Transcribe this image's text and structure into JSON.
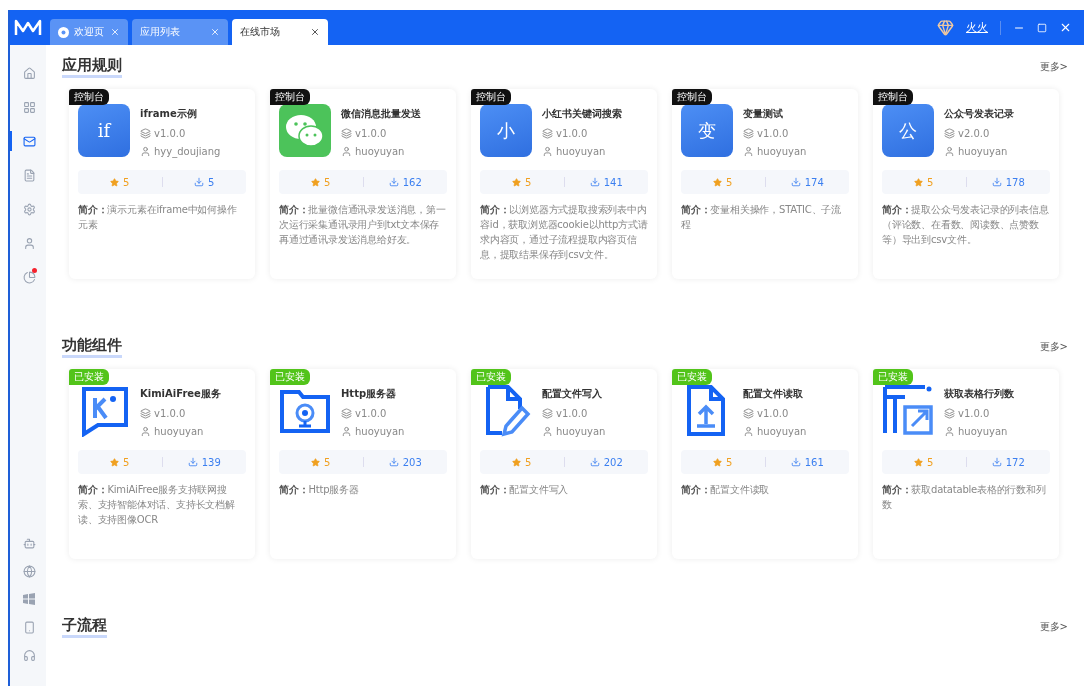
{
  "tabs": [
    {
      "label": "欢迎页",
      "selected": false,
      "kind": "welcome"
    },
    {
      "label": "应用列表",
      "selected": false,
      "kind": "plain"
    },
    {
      "label": "在线市场",
      "selected": true,
      "kind": "plain"
    }
  ],
  "user": {
    "name": "火火"
  },
  "sidebar": {
    "items": [
      {
        "kind": "home",
        "selected": false
      },
      {
        "kind": "grid",
        "selected": false
      },
      {
        "kind": "mail",
        "selected": true
      },
      {
        "kind": "list",
        "selected": false
      },
      {
        "kind": "gear",
        "selected": false
      },
      {
        "kind": "user",
        "selected": false
      },
      {
        "kind": "pie",
        "selected": false,
        "badge": true
      }
    ],
    "bottom": [
      {
        "kind": "robot"
      },
      {
        "kind": "globe"
      },
      {
        "kind": "windows"
      },
      {
        "kind": "phone"
      },
      {
        "kind": "headset"
      }
    ]
  },
  "sections": [
    {
      "title": "应用规则",
      "more": "更多>",
      "cards": [
        {
          "tag": "控制台",
          "color": "#111111",
          "icon": {
            "kind": "tile",
            "text": "if"
          },
          "name": "iframe示例",
          "version": "v1.0.0",
          "author": "hyy_doujiang",
          "stars": "5",
          "downloads": "5",
          "desc": "**简介：**演示元素在iframe中如何操作元素"
        },
        {
          "tag": "控制台",
          "color": "#111111",
          "icon": {
            "kind": "wechat"
          },
          "name": "微信消息批量发送",
          "version": "v1.0.0",
          "author": "huoyuyan",
          "stars": "5",
          "downloads": "162",
          "desc": "**简介：**批量微信通讯录发送消息，第一次运行采集通讯录用户到txt文本保存再通过通讯录发送消息给好友。"
        },
        {
          "tag": "控制台",
          "color": "#111111",
          "icon": {
            "kind": "tile",
            "text": "小"
          },
          "name": "小红书关键词搜索",
          "version": "v1.0.0",
          "author": "huoyuyan",
          "stars": "5",
          "downloads": "141",
          "desc": "**简介：**以浏览器方式提取搜索列表中内容id，获取浏览器cookie以http方式请求内容页，通过子流程提取内容页信息，提取结果保存到csv文件。"
        },
        {
          "tag": "控制台",
          "color": "#111111",
          "icon": {
            "kind": "tile",
            "text": "变"
          },
          "name": "变量测试",
          "version": "v1.0.0",
          "author": "huoyuyan",
          "stars": "5",
          "downloads": "174",
          "desc": "**简介：**变量相关操作，STATIC、子流程"
        },
        {
          "tag": "控制台",
          "color": "#111111",
          "icon": {
            "kind": "tile",
            "text": "公"
          },
          "name": "公众号发表记录",
          "version": "v2.0.0",
          "author": "huoyuyan",
          "stars": "5",
          "downloads": "178",
          "desc": "**简介：**提取公众号发表记录的列表信息（评论数、在看数、阅读数、点赞数等）导出到csv文件。"
        }
      ]
    },
    {
      "title": "功能组件",
      "more": "更多>",
      "cards": [
        {
          "tag": "已安装",
          "color": "#52c41a",
          "icon": {
            "kind": "kimi"
          },
          "name": "KimiAiFree服务",
          "version": "v1.0.0",
          "author": "huoyuyan",
          "stars": "5",
          "downloads": "139",
          "desc": "**简介：**KimiAiFree服务支持联网搜索、支持智能体对话、支持长文档解读、支持图像OCR"
        },
        {
          "tag": "已安装",
          "color": "#52c41a",
          "icon": {
            "kind": "folder"
          },
          "name": "Http服务器",
          "version": "v1.0.0",
          "author": "huoyuyan",
          "stars": "5",
          "downloads": "203",
          "desc": "**简介：**Http服务器"
        },
        {
          "tag": "已安装",
          "color": "#52c41a",
          "icon": {
            "kind": "filewrite"
          },
          "name": "配置文件写入",
          "version": "v1.0.0",
          "author": "huoyuyan",
          "stars": "5",
          "downloads": "202",
          "desc": "**简介：**配置文件写入"
        },
        {
          "tag": "已安装",
          "color": "#52c41a",
          "icon": {
            "kind": "fileread"
          },
          "name": "配置文件读取",
          "version": "v1.0.0",
          "author": "huoyuyan",
          "stars": "5",
          "downloads": "161",
          "desc": "**简介：**配置文件读取"
        },
        {
          "tag": "已安装",
          "color": "#52c41a",
          "icon": {
            "kind": "table"
          },
          "name": "获取表格行列数",
          "version": "v1.0.0",
          "author": "huoyuyan",
          "stars": "5",
          "downloads": "172",
          "desc": "**简介：**获取datatable表格的行数和列数"
        }
      ]
    },
    {
      "title": "子流程",
      "more": "更多>"
    }
  ]
}
